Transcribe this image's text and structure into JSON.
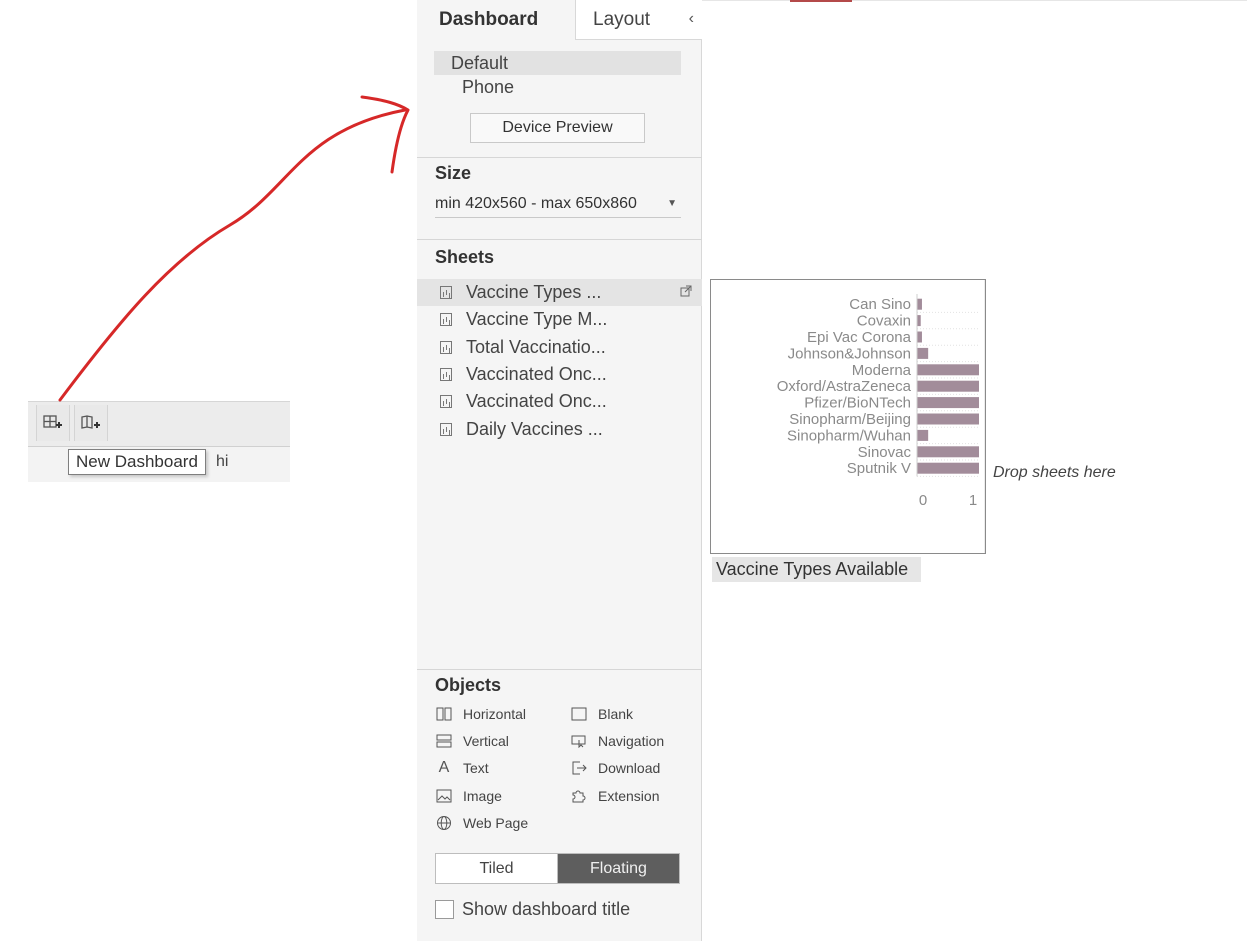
{
  "toolbar": {
    "buttons": [
      {
        "icon": "new-dashboard-icon"
      },
      {
        "icon": "new-story-icon"
      }
    ],
    "tooltip": "New Dashboard",
    "tooltip_peek": "hi"
  },
  "panel": {
    "tabs": {
      "dashboard": "Dashboard",
      "layout": "Layout",
      "collapse": "‹"
    },
    "devices": [
      "Default",
      "Phone"
    ],
    "device_preview": "Device Preview",
    "size": {
      "title": "Size",
      "value": "min 420x560 - max 650x860"
    },
    "sheets": {
      "title": "Sheets",
      "items": [
        "Vaccine Types ...",
        "Vaccine Type M...",
        "Total Vaccinatio...",
        "Vaccinated Onc...",
        "Vaccinated Onc...",
        "Daily Vaccines ..."
      ]
    },
    "objects": {
      "title": "Objects",
      "items": [
        {
          "label": "Horizontal",
          "icon": "horizontal-container-icon"
        },
        {
          "label": "Blank",
          "icon": "blank-icon"
        },
        {
          "label": "Vertical",
          "icon": "vertical-container-icon"
        },
        {
          "label": "Navigation",
          "icon": "navigation-icon"
        },
        {
          "label": "Text",
          "icon": "text-icon"
        },
        {
          "label": "Download",
          "icon": "download-icon"
        },
        {
          "label": "Image",
          "icon": "image-icon"
        },
        {
          "label": "Extension",
          "icon": "extension-icon"
        },
        {
          "label": "Web Page",
          "icon": "web-page-icon"
        }
      ]
    },
    "mode": {
      "tiled": "Tiled",
      "floating": "Floating",
      "selected": "Floating"
    },
    "show_title": {
      "label": "Show dashboard title",
      "checked": false
    }
  },
  "canvas": {
    "sheet_caption": "Vaccine Types Available",
    "drop_hint": "Drop sheets here"
  },
  "colors": {
    "bar": "#a28c9a",
    "annotation_arrow": "#d62828",
    "floating_active": "#5e5e5e"
  },
  "chart_data": {
    "type": "bar",
    "orientation": "horizontal",
    "categories": [
      "Can Sino",
      "Covaxin",
      "Epi Vac Corona",
      "Johnson&Johnson",
      "Moderna",
      "Oxford/AstraZeneca",
      "Pfizer/BioNTech",
      "Sinopharm/Beijing",
      "Sinopharm/Wuhan",
      "Sinovac",
      "Sputnik V"
    ],
    "values": [
      0.08,
      0.06,
      0.08,
      0.18,
      1,
      1,
      1,
      1,
      0.18,
      1,
      1
    ],
    "xticks": [
      "0",
      "1"
    ],
    "xlim": [
      0,
      1
    ],
    "grid": true
  }
}
